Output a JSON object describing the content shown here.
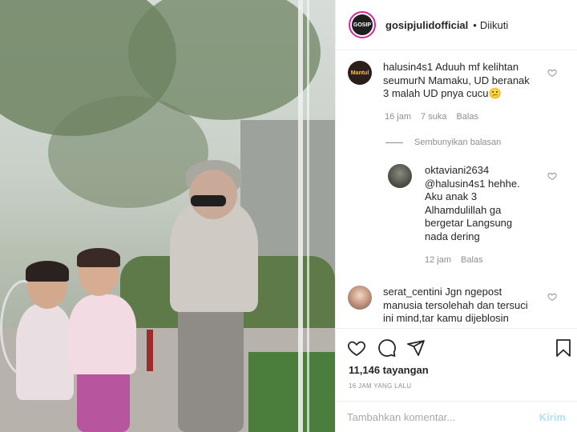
{
  "header": {
    "username": "gosipjulidofficial",
    "separator": "•",
    "follow_status": "Diikuti",
    "avatar_text": "GOSIP"
  },
  "comments": [
    {
      "username": "halusin4s1",
      "lines": [
        "Aduuh mf kelihtan",
        "seumurN Mamaku, UD beranak",
        "3 malah UD pnya cucu😕"
      ],
      "age": "16 jam",
      "likes": "7 suka",
      "reply": "Balas",
      "avatar_text": "Mantul"
    },
    {
      "username": "oktaviani2634",
      "lines": [
        "@halusin4s1 hehhe.",
        "Aku anak 3",
        "Alhamdulillah ga",
        "bergetar Langsung",
        "nada dering"
      ],
      "age": "12 jam",
      "reply": "Balas"
    },
    {
      "username": "serat_centini",
      "lines": [
        "Jgn ngepost",
        "manusia tersolehah dan tersuci",
        "ini mind,tar kamu dijeblosin"
      ]
    }
  ],
  "hide_replies_label": "Sembunyikan balasan",
  "actions": {
    "like_icon": "heart-icon",
    "comment_icon": "comment-icon",
    "share_icon": "share-icon",
    "save_icon": "bookmark-icon",
    "views": "11,146 tayangan",
    "time_ago": "16 JAM YANG LALU"
  },
  "add_comment": {
    "placeholder": "Tambahkan komentar...",
    "post_label": "Kirim"
  },
  "colors": {
    "accent": "#0095f6",
    "post_disabled": "#b2dffc",
    "muted": "#8e8e8e"
  }
}
